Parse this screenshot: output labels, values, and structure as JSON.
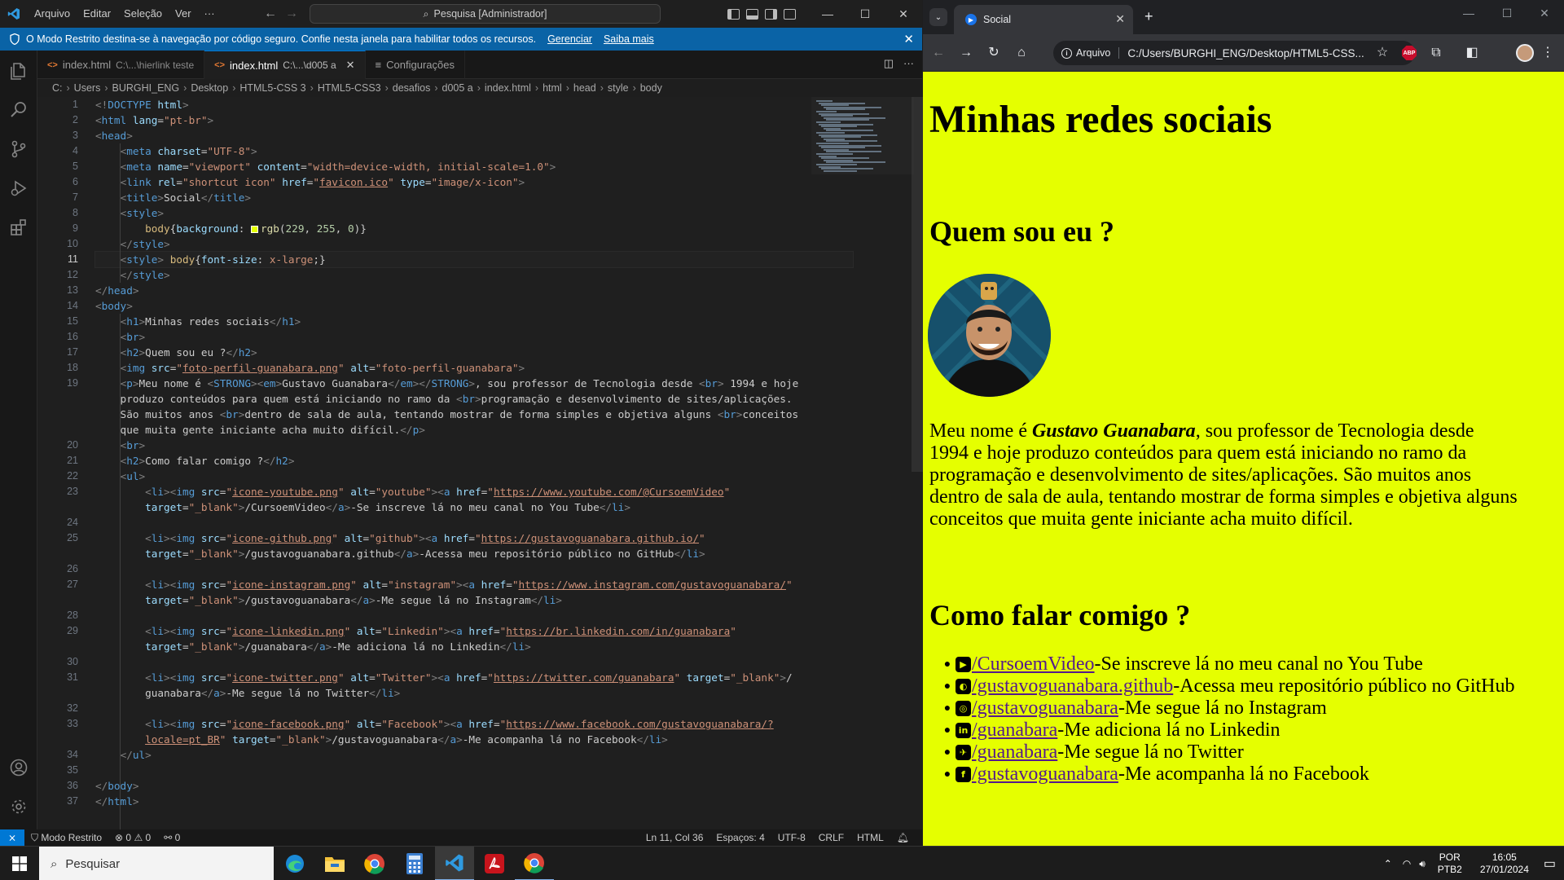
{
  "vscode": {
    "menu": [
      "Arquivo",
      "Editar",
      "Seleção",
      "Ver",
      "···"
    ],
    "command_center": "Pesquisa [Administrador]",
    "banner": {
      "text": "O Modo Restrito destina-se à navegação por código seguro. Confie nesta janela para habilitar todos os recursos.",
      "link_manage": "Gerenciar",
      "link_learn": "Saiba mais"
    },
    "tabs": [
      {
        "label": "index.html",
        "desc": "C:\\...\\hierlink teste"
      },
      {
        "label": "index.html",
        "desc": "C:\\...\\d005 a"
      },
      {
        "label": "Configurações",
        "desc": ""
      }
    ],
    "breadcrumb": [
      "C:",
      "Users",
      "BURGHI_ENG",
      "Desktop",
      "HTML5-CSS 3",
      "HTML5-CSS3",
      "desafios",
      "d005 a",
      "index.html",
      "html",
      "head",
      "style",
      "body"
    ],
    "code_lines": [
      {
        "n": "1",
        "html": "<span class=\"p\">&lt;!</span><span class=\"t\">DOCTYPE</span> <span class=\"a\">html</span><span class=\"p\">&gt;</span>"
      },
      {
        "n": "2",
        "html": "<span class=\"p\">&lt;</span><span class=\"t\">html</span> <span class=\"a\">lang</span>=<span class=\"s\">\"pt-br\"</span><span class=\"p\">&gt;</span>"
      },
      {
        "n": "3",
        "html": "<span class=\"p\">&lt;</span><span class=\"t\">head</span><span class=\"p\">&gt;</span>"
      },
      {
        "n": "4",
        "html": "    <span class=\"p\">&lt;</span><span class=\"t\">meta</span> <span class=\"a\">charset</span>=<span class=\"s\">\"UTF-8\"</span><span class=\"p\">&gt;</span>"
      },
      {
        "n": "5",
        "html": "    <span class=\"p\">&lt;</span><span class=\"t\">meta</span> <span class=\"a\">name</span>=<span class=\"s\">\"viewport\"</span> <span class=\"a\">content</span>=<span class=\"s\">\"width=device-width, initial-scale=1.0\"</span><span class=\"p\">&gt;</span>"
      },
      {
        "n": "6",
        "html": "    <span class=\"p\">&lt;</span><span class=\"t\">link</span> <span class=\"a\">rel</span>=<span class=\"s\">\"shortcut icon\"</span> <span class=\"a\">href</span>=<span class=\"s\">\"<span class=\"u\">favicon.ico</span>\"</span> <span class=\"a\">type</span>=<span class=\"s\">\"image/x-icon\"</span><span class=\"p\">&gt;</span>"
      },
      {
        "n": "7",
        "html": "    <span class=\"p\">&lt;</span><span class=\"t\">title</span><span class=\"p\">&gt;</span>Social<span class=\"p\">&lt;/</span><span class=\"t\">title</span><span class=\"p\">&gt;</span>"
      },
      {
        "n": "8",
        "html": "    <span class=\"p\">&lt;</span><span class=\"t\">style</span><span class=\"p\">&gt;</span>"
      },
      {
        "n": "9",
        "html": "        <span class=\"y\">body</span>{<span class=\"a\">background</span>: <span class=\"swatch\"></span><span class=\"f\">rgb</span>(<span class=\"n\">229</span>, <span class=\"n\">255</span>, <span class=\"n\">0</span>)}"
      },
      {
        "n": "10",
        "html": "    <span class=\"p\">&lt;/</span><span class=\"t\">style</span><span class=\"p\">&gt;</span>"
      },
      {
        "n": "11",
        "html": "    <span class=\"p\">&lt;</span><span class=\"t\">style</span><span class=\"p\">&gt;</span> <span class=\"y\">body</span>{<span class=\"a\">font-size</span>: <span class=\"s\">x-large</span>;}",
        "cur": true
      },
      {
        "n": "12",
        "html": "    <span class=\"p\">&lt;/</span><span class=\"t\">style</span><span class=\"p\">&gt;</span>"
      },
      {
        "n": "13",
        "html": "<span class=\"p\">&lt;/</span><span class=\"t\">head</span><span class=\"p\">&gt;</span>"
      },
      {
        "n": "14",
        "html": "<span class=\"p\">&lt;</span><span class=\"t\">body</span><span class=\"p\">&gt;</span>"
      },
      {
        "n": "15",
        "html": "    <span class=\"p\">&lt;</span><span class=\"t\">h1</span><span class=\"p\">&gt;</span>Minhas redes sociais<span class=\"p\">&lt;/</span><span class=\"t\">h1</span><span class=\"p\">&gt;</span>"
      },
      {
        "n": "16",
        "html": "    <span class=\"p\">&lt;</span><span class=\"t\">br</span><span class=\"p\">&gt;</span>"
      },
      {
        "n": "17",
        "html": "    <span class=\"p\">&lt;</span><span class=\"t\">h2</span><span class=\"p\">&gt;</span>Quem sou eu ?<span class=\"p\">&lt;/</span><span class=\"t\">h2</span><span class=\"p\">&gt;</span>"
      },
      {
        "n": "18",
        "html": "    <span class=\"p\">&lt;</span><span class=\"t\">img</span> <span class=\"a\">src</span>=<span class=\"s\">\"<span class=\"u\">foto-perfil-guanabara.png</span>\"</span> <span class=\"a\">alt</span>=<span class=\"s\">\"foto-perfil-guanabara\"</span><span class=\"p\">&gt;</span>"
      },
      {
        "n": "19",
        "html": "    <span class=\"p\">&lt;</span><span class=\"t\">p</span><span class=\"p\">&gt;</span>Meu nome é <span class=\"p\">&lt;</span><span class=\"t\">STRONG</span><span class=\"p\">&gt;&lt;</span><span class=\"t\">em</span><span class=\"p\">&gt;</span>Gustavo Guanabara<span class=\"p\">&lt;/</span><span class=\"t\">em</span><span class=\"p\">&gt;&lt;/</span><span class=\"t\">STRONG</span><span class=\"p\">&gt;</span>, sou professor de Tecnologia desde <span class=\"p\">&lt;</span><span class=\"t\">br</span><span class=\"p\">&gt;</span> 1994 e hoje"
      },
      {
        "n": "",
        "html": "    produzo conteúdos para quem está iniciando no ramo da <span class=\"p\">&lt;</span><span class=\"t\">br</span><span class=\"p\">&gt;</span>programação e desenvolvimento de sites/aplicações."
      },
      {
        "n": "",
        "html": "    São muitos anos <span class=\"p\">&lt;</span><span class=\"t\">br</span><span class=\"p\">&gt;</span>dentro de sala de aula, tentando mostrar de forma simples e objetiva alguns <span class=\"p\">&lt;</span><span class=\"t\">br</span><span class=\"p\">&gt;</span>conceitos"
      },
      {
        "n": "",
        "html": "    que muita gente iniciante acha muito difícil.<span class=\"p\">&lt;/</span><span class=\"t\">p</span><span class=\"p\">&gt;</span>"
      },
      {
        "n": "20",
        "html": "    <span class=\"p\">&lt;</span><span class=\"t\">br</span><span class=\"p\">&gt;</span>"
      },
      {
        "n": "21",
        "html": "    <span class=\"p\">&lt;</span><span class=\"t\">h2</span><span class=\"p\">&gt;</span>Como falar comigo ?<span class=\"p\">&lt;/</span><span class=\"t\">h2</span><span class=\"p\">&gt;</span>"
      },
      {
        "n": "22",
        "html": "    <span class=\"p\">&lt;</span><span class=\"t\">ul</span><span class=\"p\">&gt;</span>"
      },
      {
        "n": "23",
        "html": "        <span class=\"p\">&lt;</span><span class=\"t\">li</span><span class=\"p\">&gt;&lt;</span><span class=\"t\">img</span> <span class=\"a\">src</span>=<span class=\"s\">\"<span class=\"u\">icone-youtube.png</span>\"</span> <span class=\"a\">alt</span>=<span class=\"s\">\"youtube\"</span><span class=\"p\">&gt;&lt;</span><span class=\"t\">a</span> <span class=\"a\">href</span>=<span class=\"s\">\"<span class=\"u\">https://www.youtube.com/@CursoemVideo</span>\"</span>"
      },
      {
        "n": "",
        "html": "        <span class=\"a\">target</span>=<span class=\"s\">\"_blank\"</span><span class=\"p\">&gt;</span>/CursoemVideo<span class=\"p\">&lt;/</span><span class=\"t\">a</span><span class=\"p\">&gt;</span>-Se inscreve lá no meu canal no You Tube<span class=\"p\">&lt;/</span><span class=\"t\">li</span><span class=\"p\">&gt;</span>"
      },
      {
        "n": "24",
        "html": ""
      },
      {
        "n": "25",
        "html": "        <span class=\"p\">&lt;</span><span class=\"t\">li</span><span class=\"p\">&gt;&lt;</span><span class=\"t\">img</span> <span class=\"a\">src</span>=<span class=\"s\">\"<span class=\"u\">icone-github.png</span>\"</span> <span class=\"a\">alt</span>=<span class=\"s\">\"github\"</span><span class=\"p\">&gt;&lt;</span><span class=\"t\">a</span> <span class=\"a\">href</span>=<span class=\"s\">\"<span class=\"u\">https://gustavoguanabara.github.io/</span>\"</span>"
      },
      {
        "n": "",
        "html": "        <span class=\"a\">target</span>=<span class=\"s\">\"_blank\"</span><span class=\"p\">&gt;</span>/gustavoguanabara.github<span class=\"p\">&lt;/</span><span class=\"t\">a</span><span class=\"p\">&gt;</span>-Acessa meu repositório público no GitHub<span class=\"p\">&lt;/</span><span class=\"t\">li</span><span class=\"p\">&gt;</span>"
      },
      {
        "n": "26",
        "html": ""
      },
      {
        "n": "27",
        "html": "        <span class=\"p\">&lt;</span><span class=\"t\">li</span><span class=\"p\">&gt;&lt;</span><span class=\"t\">img</span> <span class=\"a\">src</span>=<span class=\"s\">\"<span class=\"u\">icone-instagram.png</span>\"</span> <span class=\"a\">alt</span>=<span class=\"s\">\"instagram\"</span><span class=\"p\">&gt;&lt;</span><span class=\"t\">a</span> <span class=\"a\">href</span>=<span class=\"s\">\"<span class=\"u\">https://www.instagram.com/gustavoguanabara/</span>\"</span>"
      },
      {
        "n": "",
        "html": "        <span class=\"a\">target</span>=<span class=\"s\">\"_blank\"</span><span class=\"p\">&gt;</span>/gustavoguanabara<span class=\"p\">&lt;/</span><span class=\"t\">a</span><span class=\"p\">&gt;</span>-Me segue lá no Instagram<span class=\"p\">&lt;/</span><span class=\"t\">li</span><span class=\"p\">&gt;</span>"
      },
      {
        "n": "28",
        "html": ""
      },
      {
        "n": "29",
        "html": "        <span class=\"p\">&lt;</span><span class=\"t\">li</span><span class=\"p\">&gt;&lt;</span><span class=\"t\">img</span> <span class=\"a\">src</span>=<span class=\"s\">\"<span class=\"u\">icone-linkedin.png</span>\"</span> <span class=\"a\">alt</span>=<span class=\"s\">\"Linkedin\"</span><span class=\"p\">&gt;&lt;</span><span class=\"t\">a</span> <span class=\"a\">href</span>=<span class=\"s\">\"<span class=\"u\">https://br.linkedin.com/in/guanabara</span>\"</span>"
      },
      {
        "n": "",
        "html": "        <span class=\"a\">target</span>=<span class=\"s\">\"_blank\"</span><span class=\"p\">&gt;</span>/guanabara<span class=\"p\">&lt;/</span><span class=\"t\">a</span><span class=\"p\">&gt;</span>-Me adiciona lá no Linkedin<span class=\"p\">&lt;/</span><span class=\"t\">li</span><span class=\"p\">&gt;</span>"
      },
      {
        "n": "30",
        "html": ""
      },
      {
        "n": "31",
        "html": "        <span class=\"p\">&lt;</span><span class=\"t\">li</span><span class=\"p\">&gt;&lt;</span><span class=\"t\">img</span> <span class=\"a\">src</span>=<span class=\"s\">\"<span class=\"u\">icone-twitter.png</span>\"</span> <span class=\"a\">alt</span>=<span class=\"s\">\"Twitter\"</span><span class=\"p\">&gt;&lt;</span><span class=\"t\">a</span> <span class=\"a\">href</span>=<span class=\"s\">\"<span class=\"u\">https://twitter.com/guanabara</span>\"</span> <span class=\"a\">target</span>=<span class=\"s\">\"_blank\"</span><span class=\"p\">&gt;</span>/"
      },
      {
        "n": "",
        "html": "        guanabara<span class=\"p\">&lt;/</span><span class=\"t\">a</span><span class=\"p\">&gt;</span>-Me segue lá no Twitter<span class=\"p\">&lt;/</span><span class=\"t\">li</span><span class=\"p\">&gt;</span>"
      },
      {
        "n": "32",
        "html": ""
      },
      {
        "n": "33",
        "html": "        <span class=\"p\">&lt;</span><span class=\"t\">li</span><span class=\"p\">&gt;&lt;</span><span class=\"t\">img</span> <span class=\"a\">src</span>=<span class=\"s\">\"<span class=\"u\">icone-facebook.png</span>\"</span> <span class=\"a\">alt</span>=<span class=\"s\">\"Facebook\"</span><span class=\"p\">&gt;&lt;</span><span class=\"t\">a</span> <span class=\"a\">href</span>=<span class=\"s\">\"<span class=\"u\">https://www.facebook.com/gustavoguanabara/?</span></span>"
      },
      {
        "n": "",
        "html": "        <span class=\"s\"><span class=\"u\">locale=pt_BR</span>\"</span> <span class=\"a\">target</span>=<span class=\"s\">\"_blank\"</span><span class=\"p\">&gt;</span>/gustavoguanabara<span class=\"p\">&lt;/</span><span class=\"t\">a</span><span class=\"p\">&gt;</span>-Me acompanha lá no Facebook<span class=\"p\">&lt;/</span><span class=\"t\">li</span><span class=\"p\">&gt;</span>"
      },
      {
        "n": "34",
        "html": "    <span class=\"p\">&lt;/</span><span class=\"t\">ul</span><span class=\"p\">&gt;</span>"
      },
      {
        "n": "35",
        "html": ""
      },
      {
        "n": "36",
        "html": "<span class=\"p\">&lt;/</span><span class=\"t\">body</span><span class=\"p\">&gt;</span>"
      },
      {
        "n": "37",
        "html": "<span class=\"p\">&lt;/</span><span class=\"t\">html</span><span class=\"p\">&gt;</span>"
      }
    ],
    "status": {
      "restricted": "Modo Restrito",
      "problems": "⊗ 0 ⚠ 0",
      "ports": "⚯ 0",
      "cursor": "Ln 11, Col 36",
      "spaces": "Espaços: 4",
      "encoding": "UTF-8",
      "eol": "CRLF",
      "language": "HTML"
    }
  },
  "chrome": {
    "tab_title": "Social",
    "address_chip": "Arquivo",
    "address": "C:/Users/BURGHI_ENG/Desktop/HTML5-CSS...",
    "abp_label": "ABP"
  },
  "page": {
    "h1": "Minhas redes sociais",
    "h2_about": "Quem sou eu ?",
    "para_pre": "Meu nome é ",
    "para_name": "Gustavo Guanabara",
    "para_line1_rest": ", sou professor de Tecnologia desde",
    "para_line2": "1994 e hoje produzo conteúdos para quem está iniciando no ramo da",
    "para_line3": "programação e desenvolvimento de sites/aplicações. São muitos anos",
    "para_line4": "dentro de sala de aula, tentando mostrar de forma simples e objetiva alguns",
    "para_line5": "conceitos que muita gente iniciante acha muito difícil.",
    "h2_contact": "Como falar comigo ?",
    "social": [
      {
        "icon": "youtube-icon",
        "glyph": "▶",
        "link": "/CursoemVideo",
        "text": "-Se inscreve lá no meu canal no You Tube"
      },
      {
        "icon": "github-icon",
        "glyph": "◐",
        "link": "/gustavoguanabara.github",
        "text": "-Acessa meu repositório público no GitHub"
      },
      {
        "icon": "instagram-icon",
        "glyph": "◎",
        "link": "/gustavoguanabara",
        "text": "-Me segue lá no Instagram"
      },
      {
        "icon": "linkedin-icon",
        "glyph": "in",
        "link": "/guanabara",
        "text": "-Me adiciona lá no Linkedin"
      },
      {
        "icon": "twitter-icon",
        "glyph": "✈",
        "link": "/guanabara",
        "text": "-Me segue lá no Twitter"
      },
      {
        "icon": "facebook-icon",
        "glyph": "f",
        "link": "/gustavoguanabara",
        "text": "-Me acompanha lá no Facebook"
      }
    ],
    "background": "#e5ff00"
  },
  "taskbar": {
    "search_placeholder": "Pesquisar",
    "lang_top": "POR",
    "lang_bottom": "PTB2",
    "time": "16:05",
    "date": "27/01/2024"
  }
}
